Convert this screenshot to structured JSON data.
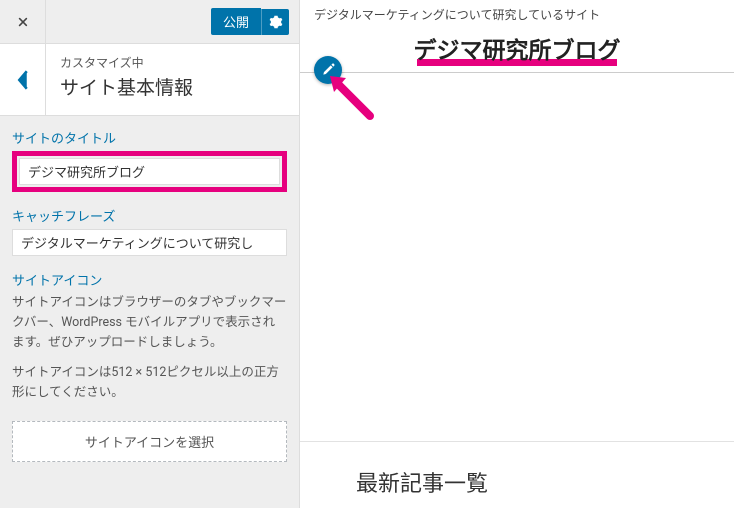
{
  "topbar": {
    "publish_label": "公開"
  },
  "section": {
    "breadcrumb": "カスタマイズ中",
    "title": "サイト基本情報"
  },
  "fields": {
    "site_title_label": "サイトのタイトル",
    "site_title_value": "デジマ研究所ブログ",
    "tagline_label": "キャッチフレーズ",
    "tagline_value": "デジタルマーケティングについて研究し"
  },
  "site_icon": {
    "heading": "サイトアイコン",
    "description1": "サイトアイコンはブラウザーのタブやブックマークバー、WordPress モバイルアプリで表示されます。ぜひアップロードしましょう。",
    "description2": "サイトアイコンは512 × 512ピクセル以上の正方形にしてください。",
    "select_label": "サイトアイコンを選択"
  },
  "preview": {
    "tagline": "デジタルマーケティングについて研究しているサイト",
    "site_title": "デジマ研究所ブログ",
    "latest_heading": "最新記事一覧"
  }
}
